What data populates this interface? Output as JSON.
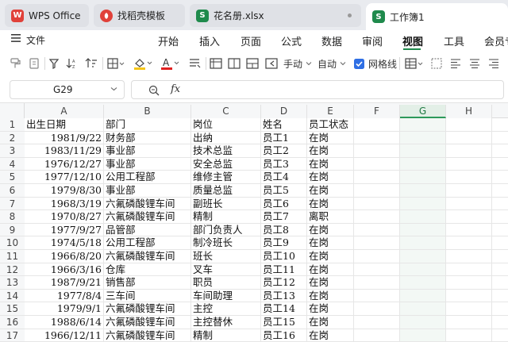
{
  "tabs": [
    {
      "label": "WPS Office",
      "icon": "wps-logo-icon"
    },
    {
      "label": "找稻壳模板",
      "icon": "docer-logo-icon"
    },
    {
      "label": "花名册.xlsx",
      "icon": "spreadsheet-file-icon"
    },
    {
      "label": "工作簿1",
      "icon": "spreadsheet-file-icon"
    }
  ],
  "menu": {
    "file_label": "文件",
    "items": [
      "开始",
      "插入",
      "页面",
      "公式",
      "数据",
      "审阅",
      "视图",
      "工具",
      "会员专"
    ],
    "active": "视图"
  },
  "toolbar": {
    "manual_label": "手动",
    "auto_label": "自动",
    "gridlines_label": "网格线",
    "gridlines_checked": true
  },
  "formula": {
    "cell_ref": "G29",
    "fx_label": "fx",
    "value": ""
  },
  "colors": {
    "accent": "#1f8a4c",
    "wps_red": "#e0413a",
    "sheet_green": "#1f8a4c",
    "fill_yellow": "#f5c518",
    "font_red": "#e02020"
  },
  "columns": [
    "A",
    "B",
    "C",
    "D",
    "E",
    "F",
    "G",
    "H"
  ],
  "selected_column": "G",
  "rows": [
    {
      "n": "1",
      "a": "出生日期",
      "b": "部门",
      "c": "岗位",
      "d": "姓名",
      "e": "员工状态"
    },
    {
      "n": "2",
      "a": "1981/9/22",
      "b": "财务部",
      "c": "出纳",
      "d": "员工1",
      "e": "在岗"
    },
    {
      "n": "3",
      "a": "1983/11/29",
      "b": "事业部",
      "c": "技术总监",
      "d": "员工2",
      "e": "在岗"
    },
    {
      "n": "4",
      "a": "1976/12/27",
      "b": "事业部",
      "c": "安全总监",
      "d": "员工3",
      "e": "在岗"
    },
    {
      "n": "5",
      "a": "1977/12/10",
      "b": "公用工程部",
      "c": "维修主管",
      "d": "员工4",
      "e": "在岗"
    },
    {
      "n": "6",
      "a": "1979/8/30",
      "b": "事业部",
      "c": "质量总监",
      "d": "员工5",
      "e": "在岗"
    },
    {
      "n": "7",
      "a": "1968/3/19",
      "b": "六氟磷酸锂车间",
      "c": "副班长",
      "d": "员工6",
      "e": "在岗"
    },
    {
      "n": "8",
      "a": "1970/8/27",
      "b": "六氟磷酸锂车间",
      "c": "精制",
      "d": "员工7",
      "e": "离职"
    },
    {
      "n": "9",
      "a": "1977/9/27",
      "b": "品管部",
      "c": "部门负责人",
      "d": "员工8",
      "e": "在岗"
    },
    {
      "n": "10",
      "a": "1974/5/18",
      "b": "公用工程部",
      "c": "制冷班长",
      "d": "员工9",
      "e": "在岗"
    },
    {
      "n": "11",
      "a": "1966/8/20",
      "b": "六氟磷酸锂车间",
      "c": "班长",
      "d": "员工10",
      "e": "在岗"
    },
    {
      "n": "12",
      "a": "1966/3/16",
      "b": "仓库",
      "c": "叉车",
      "d": "员工11",
      "e": "在岗"
    },
    {
      "n": "13",
      "a": "1987/9/21",
      "b": "销售部",
      "c": "职员",
      "d": "员工12",
      "e": "在岗"
    },
    {
      "n": "14",
      "a": "1977/8/4",
      "b": "三车间",
      "c": "车间助理",
      "d": "员工13",
      "e": "在岗"
    },
    {
      "n": "15",
      "a": "1979/9/1",
      "b": "六氟磷酸锂车间",
      "c": "主控",
      "d": "员工14",
      "e": "在岗"
    },
    {
      "n": "16",
      "a": "1988/6/14",
      "b": "六氟磷酸锂车间",
      "c": "主控替休",
      "d": "员工15",
      "e": "在岗"
    },
    {
      "n": "17",
      "a": "1966/12/11",
      "b": "六氟磷酸锂车间",
      "c": "精制",
      "d": "员工16",
      "e": "在岗"
    }
  ]
}
